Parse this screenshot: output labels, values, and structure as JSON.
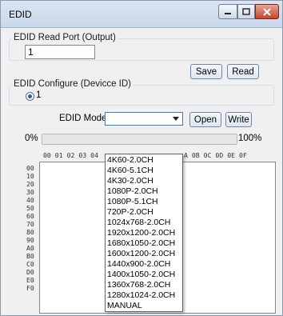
{
  "window": {
    "title": "EDID"
  },
  "read_port": {
    "group_label": "EDID Read Port (Output)",
    "value": "1"
  },
  "buttons": {
    "save": "Save",
    "read": "Read",
    "open": "Open",
    "write": "Write"
  },
  "configure": {
    "group_label": "EDID Configure (Devicce ID)",
    "radio_label": "1",
    "selected": true
  },
  "mode": {
    "label": "EDID Mode",
    "selected_value": ""
  },
  "progress": {
    "start_label": "0%",
    "end_label": "100%",
    "value": 0
  },
  "hex": {
    "header_left": "00 01 02 03 04",
    "header_right": "A 0B 0C 0D 0E 0F",
    "rows": [
      "00",
      "10",
      "20",
      "30",
      "40",
      "50",
      "60",
      "70",
      "80",
      "90",
      "A0",
      "B0",
      "C0",
      "D0",
      "E0",
      "F0"
    ]
  },
  "dropdown": {
    "options": [
      "4K60-2.0CH",
      "4K60-5.1CH",
      "4K30-2.0CH",
      "1080P-2.0CH",
      "1080P-5.1CH",
      "720P-2.0CH",
      "1024x768-2.0CH",
      "1920x1200-2.0CH",
      "1680x1050-2.0CH",
      "1600x1200-2.0CH",
      "1440x900-2.0CH",
      "1400x1050-2.0CH",
      "1360x768-2.0CH",
      "1280x1024-2.0CH",
      "MANUAL"
    ]
  },
  "colors": {
    "accent": "#3c7fb1",
    "title_bar": "#c8d7ea",
    "close_button": "#c7452a"
  }
}
